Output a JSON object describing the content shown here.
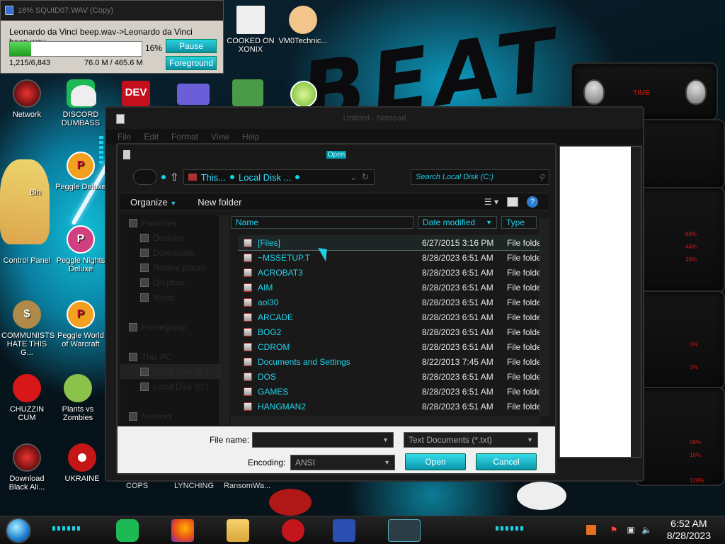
{
  "copy_dialog": {
    "title": "16% SQUID07.WAV (Copy)",
    "filename": "Leonardo da Vinci beep.wav->Leonardo da Vinci beep.wav",
    "progress_percent": 16,
    "progress_label": "16%",
    "pause_label": "Pause",
    "foreground_label": "Foreground",
    "count_text": "1,215/6,843",
    "size_text": "76.0 M / 465.6 M"
  },
  "desktop_icons": [
    {
      "label": "Network",
      "icon": "network-orb-icon"
    },
    {
      "label": "DISCORD DUMBASS",
      "icon": "discord-icon"
    },
    {
      "label": "Bin",
      "icon": "recycle-bin-icon"
    },
    {
      "label": "Peggle Deluxe",
      "icon": "peggle-icon"
    },
    {
      "label": "Control Panel",
      "icon": "control-panel-icon"
    },
    {
      "label": "Peggle Nights Deluxe",
      "icon": "peggle-nights-icon"
    },
    {
      "label": "COMMUNISTS HATE THIS G...",
      "icon": "money-bag-icon"
    },
    {
      "label": "Peggle World of Warcraft",
      "icon": "peggle-wow-icon"
    },
    {
      "label": "CHUZZIN CUM",
      "icon": "chuzzle-icon"
    },
    {
      "label": "Plants vs Zombies",
      "icon": "pvz-icon"
    },
    {
      "label": "Download Black Ali...",
      "icon": "alien-orb-icon"
    },
    {
      "label": "UKRAINE",
      "icon": "ukraine-icon"
    },
    {
      "label": "COOKED ON XONIX",
      "icon": "xonix-icon"
    },
    {
      "label": "VM0Technic...",
      "icon": "technician-icon"
    }
  ],
  "desktop_bottom_labels": [
    "COPS",
    "LYNCHING",
    "RansomWa..."
  ],
  "notepad": {
    "title": "Untitled - Notepad",
    "menu": [
      "File",
      "Edit",
      "Format",
      "View",
      "Help"
    ]
  },
  "open_dialog": {
    "title": "Open",
    "breadcrumb": [
      "This...",
      "Local Disk ..."
    ],
    "search_placeholder": "Search Local Disk (C:)",
    "organize_label": "Organize",
    "new_folder_label": "New folder",
    "columns": {
      "name": "Name",
      "date": "Date modified",
      "type": "Type"
    },
    "nav_items": [
      {
        "label": "Favorites",
        "indent": false
      },
      {
        "label": "Desktop",
        "indent": true
      },
      {
        "label": "Downloads",
        "indent": true
      },
      {
        "label": "Recent places",
        "indent": true
      },
      {
        "label": "Dropbox",
        "indent": true
      },
      {
        "label": "Music",
        "indent": true
      },
      {
        "label": "",
        "indent": false
      },
      {
        "label": "Homegroup",
        "indent": false
      },
      {
        "label": "",
        "indent": false
      },
      {
        "label": "This PC",
        "indent": false
      },
      {
        "label": "Local Disk (C:)",
        "indent": true
      },
      {
        "label": "Local Disk (D:)",
        "indent": true
      },
      {
        "label": "",
        "indent": false
      },
      {
        "label": "Network",
        "indent": false
      }
    ],
    "files": [
      {
        "name": "[Files]",
        "date": "6/27/2015 3:16 PM",
        "type": "File folder"
      },
      {
        "name": "~MSSETUP.T",
        "date": "8/28/2023 6:51 AM",
        "type": "File folder"
      },
      {
        "name": "ACROBAT3",
        "date": "8/28/2023 6:51 AM",
        "type": "File folder"
      },
      {
        "name": "AIM",
        "date": "8/28/2023 6:51 AM",
        "type": "File folder"
      },
      {
        "name": "aol30",
        "date": "8/28/2023 6:51 AM",
        "type": "File folder"
      },
      {
        "name": "ARCADE",
        "date": "8/28/2023 6:51 AM",
        "type": "File folder"
      },
      {
        "name": "BOG2",
        "date": "8/28/2023 6:51 AM",
        "type": "File folder"
      },
      {
        "name": "CDROM",
        "date": "8/28/2023 6:51 AM",
        "type": "File folder"
      },
      {
        "name": "Documents and Settings",
        "date": "8/22/2013 7:45 AM",
        "type": "File folder"
      },
      {
        "name": "DOS",
        "date": "8/28/2023 6:51 AM",
        "type": "File folder"
      },
      {
        "name": "GAMES",
        "date": "8/28/2023 6:51 AM",
        "type": "File folder"
      },
      {
        "name": "HANGMAN2",
        "date": "8/28/2023 6:51 AM",
        "type": "File folder"
      }
    ],
    "file_name_label": "File name:",
    "file_name_value": "",
    "file_type_value": "Text Documents (*.txt)",
    "encoding_label": "Encoding:",
    "encoding_value": "ANSI",
    "open_button": "Open",
    "cancel_button": "Cancel"
  },
  "gadget": {
    "time_label": "TIME",
    "readouts": [
      "68%",
      "44%",
      "36%",
      "0%",
      "0%",
      "28%",
      "16%",
      "128%"
    ]
  },
  "taskbar": {
    "time": "6:52 AM",
    "date": "8/28/2023"
  },
  "wallpaper_text": "BEAT"
}
